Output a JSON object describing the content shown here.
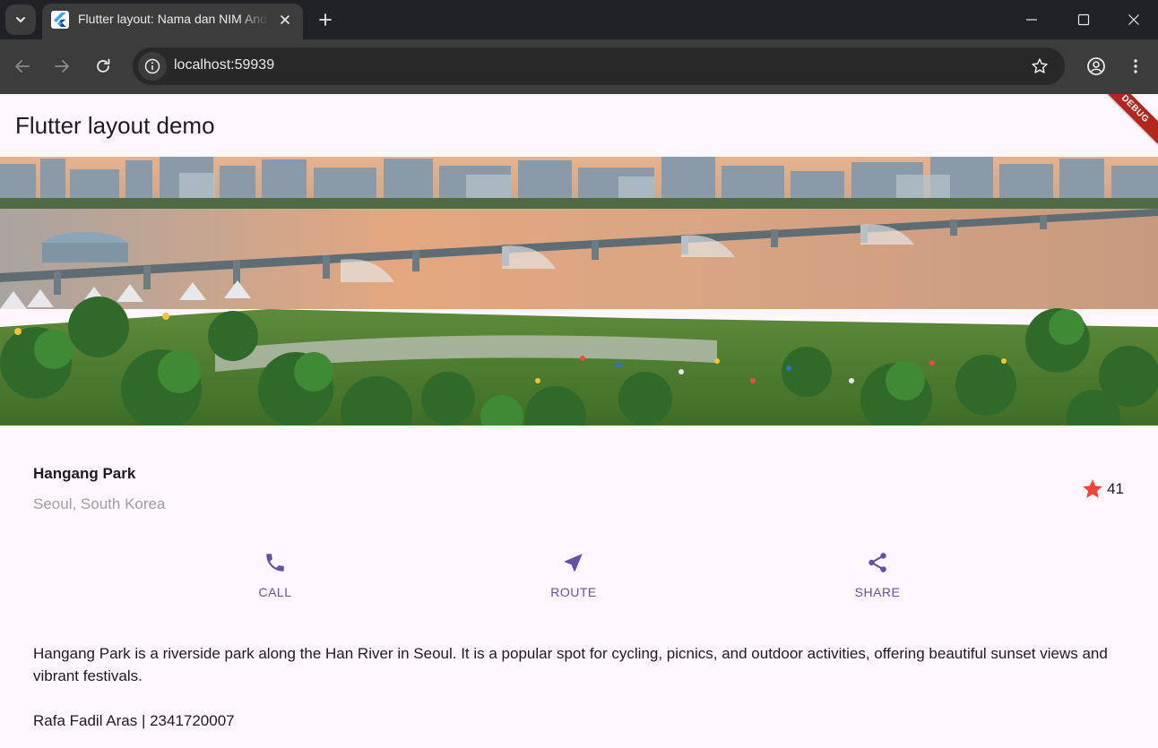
{
  "browser": {
    "tab_title": "Flutter layout: Nama dan NIM Anda",
    "url": "localhost:59939"
  },
  "app": {
    "title": "Flutter layout demo",
    "debug_banner": "DEBUG"
  },
  "location": {
    "name": "Hangang Park",
    "region": "Seoul, South Korea",
    "rating_count": "41"
  },
  "actions": [
    {
      "label": "CALL",
      "icon": "phone-icon"
    },
    {
      "label": "ROUTE",
      "icon": "near-me-icon"
    },
    {
      "label": "SHARE",
      "icon": "share-icon"
    }
  ],
  "description": "Hangang Park is a riverside park along the Han River in Seoul. It is a popular spot for cycling, picnics, and outdoor activities, offering beautiful sunset views and vibrant festivals.",
  "author": "Rafa Fadil Aras | 2341720007",
  "colors": {
    "primary": "#6750a4",
    "star": "#f44336",
    "surface": "#fef7ff",
    "chrome_dark": "#202124",
    "chrome_toolbar": "#3c3c3c"
  }
}
